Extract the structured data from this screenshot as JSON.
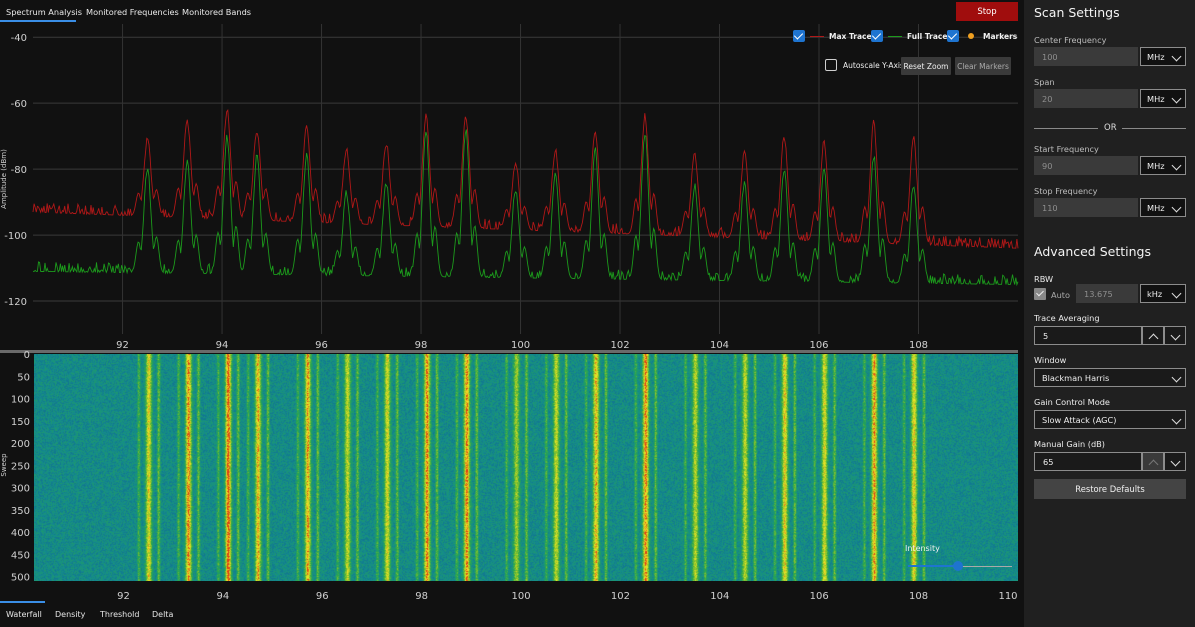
{
  "tabs": [
    {
      "label": "Spectrum Analysis",
      "selected": true
    },
    {
      "label": "Monitored Frequencies",
      "selected": false
    },
    {
      "label": "Monitored Bands",
      "selected": false
    }
  ],
  "stop_label": "Stop",
  "legend": {
    "max_trace": "Max Trace",
    "full_trace": "Full Trace",
    "markers": "Markers",
    "max_trace_color": "#b01818",
    "full_trace_color": "#1c9a1c",
    "markers_color": "#f0a020"
  },
  "autoscale_label": "Autoscale Y-Axis",
  "reset_zoom_label": "Reset Zoom",
  "clear_markers_label": "Clear Markers",
  "bottom_tabs": [
    {
      "label": "Waterfall",
      "selected": true
    },
    {
      "label": "Density",
      "selected": false
    },
    {
      "label": "Threshold",
      "selected": false
    },
    {
      "label": "Delta",
      "selected": false
    }
  ],
  "intensity_label": "Intensity",
  "intensity_level": 0.48,
  "chart_data": [
    {
      "type": "line",
      "ylabel": "Amplitude (dBm)",
      "xlim": [
        90.2,
        110
      ],
      "ylim": [
        -130,
        -36
      ],
      "x_ticks": [
        92,
        94,
        96,
        98,
        100,
        102,
        104,
        106,
        108
      ],
      "y_ticks": [
        -40,
        -60,
        -80,
        -100,
        -120
      ],
      "grid": true,
      "legend_position": "top-right",
      "peaks_mhz": [
        92.5,
        93.3,
        94.1,
        94.7,
        95.7,
        96.5,
        97.3,
        98.1,
        98.9,
        99.9,
        100.7,
        101.5,
        102.5,
        103.5,
        104.5,
        105.3,
        106.1,
        107.1,
        107.9
      ],
      "series": [
        {
          "name": "Max Trace",
          "color": "#b01818",
          "baseline_start": -93,
          "baseline_end": -104,
          "peak_values": [
            -71,
            -65,
            -62,
            -68,
            -67,
            -74,
            -72,
            -64,
            -64,
            -78,
            -74,
            -68,
            -64,
            -75,
            -75,
            -70,
            -72,
            -66,
            -70
          ]
        },
        {
          "name": "Full Trace",
          "color": "#1c9a1c",
          "baseline_start": -111,
          "baseline_end": -115,
          "peak_values": [
            -80,
            -78,
            -70,
            -76,
            -76,
            -87,
            -84,
            -69,
            -68,
            -86,
            -81,
            -74,
            -69,
            -85,
            -84,
            -80,
            -80,
            -76,
            -85
          ]
        }
      ]
    },
    {
      "type": "heatmap",
      "ylabel": "Sweep",
      "xlim": [
        90.2,
        110
      ],
      "ylim": [
        0,
        510
      ],
      "x_ticks": [
        92,
        94,
        96,
        98,
        100,
        102,
        104,
        106,
        108,
        110
      ],
      "y_ticks": [
        0,
        50,
        100,
        150,
        200,
        250,
        300,
        350,
        400,
        450,
        500
      ]
    }
  ],
  "scan_settings": {
    "title": "Scan Settings",
    "center_frequency_label": "Center Frequency",
    "center_frequency_value": "100",
    "center_frequency_unit": "MHz",
    "span_label": "Span",
    "span_value": "20",
    "span_unit": "MHz",
    "or_label": "OR",
    "start_frequency_label": "Start Frequency",
    "start_frequency_value": "90",
    "start_frequency_unit": "MHz",
    "stop_frequency_label": "Stop Frequency",
    "stop_frequency_value": "110",
    "stop_frequency_unit": "MHz"
  },
  "advanced_settings": {
    "title": "Advanced Settings",
    "rbw_label": "RBW",
    "rbw_auto_label": "Auto",
    "rbw_value": "13.675",
    "rbw_unit": "kHz",
    "trace_averaging_label": "Trace Averaging",
    "trace_averaging_value": "5",
    "window_label": "Window",
    "window_value": "Blackman Harris",
    "gain_control_mode_label": "Gain Control Mode",
    "gain_control_mode_value": "Slow Attack (AGC)",
    "manual_gain_label": "Manual Gain (dB)",
    "manual_gain_value": "65",
    "restore_defaults_label": "Restore Defaults"
  }
}
